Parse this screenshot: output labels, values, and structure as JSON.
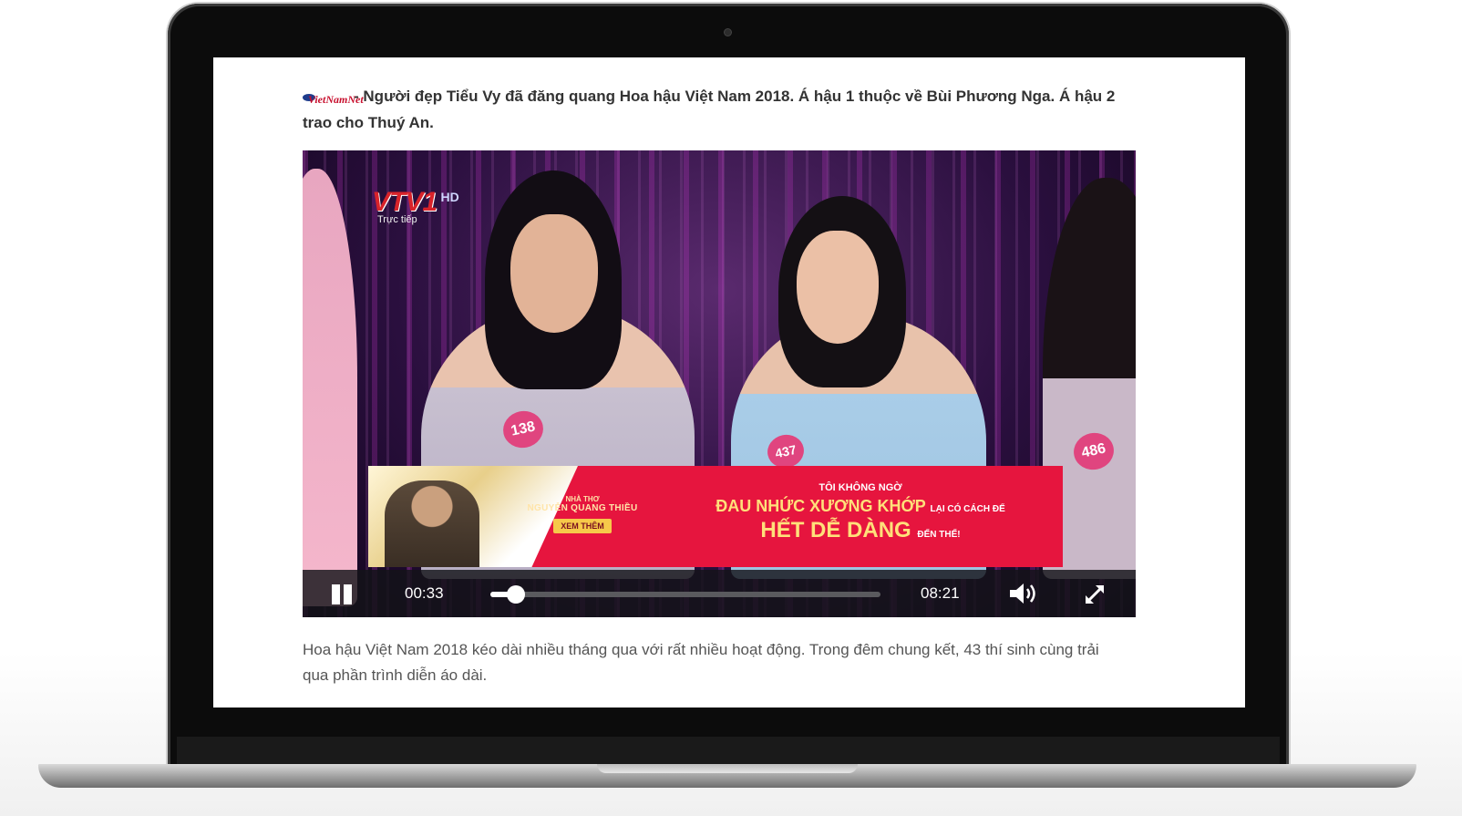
{
  "article": {
    "site_logo_text": "VietNamNet",
    "lede_sep": "-",
    "lede": "Người đẹp Tiểu Vy đã đăng quang Hoa hậu Việt Nam 2018. Á hậu 1 thuộc về Bùi Phương Nga. Á hậu 2 trao cho Thuý An.",
    "body": "Hoa hậu Việt Nam 2018 kéo dài nhiều tháng qua với rất nhiều hoạt động. Trong đêm chung kết, 43 thí sinh cùng trải qua phần trình diễn áo dài."
  },
  "video": {
    "channel_logo": "VTV1",
    "channel_quality": "HD",
    "live_label": "Trực tiếp",
    "contestant_tags": [
      "138",
      "437",
      "486"
    ],
    "player": {
      "current_time": "00:33",
      "duration": "08:21",
      "progress_fraction": 0.066,
      "pause_icon": "pause-icon",
      "volume_icon": "volume-icon",
      "fullscreen_icon": "fullscreen-icon"
    }
  },
  "ad": {
    "author_pre": "NHÀ THƠ",
    "author_name": "NGUYỄN QUANG THIỀU",
    "cta": "XEM THÊM",
    "line1": "TÔI KHÔNG NGỜ",
    "line2_main": "ĐAU NHỨC XƯƠNG KHỚP",
    "line2_small": "LẠI CÓ CÁCH ĐỂ",
    "line3_main": "HẾT DỄ DÀNG",
    "line3_small": "ĐẾN THẾ!"
  },
  "colors": {
    "ad_red": "#e6153e",
    "tag_pink": "#e0457f",
    "stage_purple": "#5a2a6e"
  }
}
